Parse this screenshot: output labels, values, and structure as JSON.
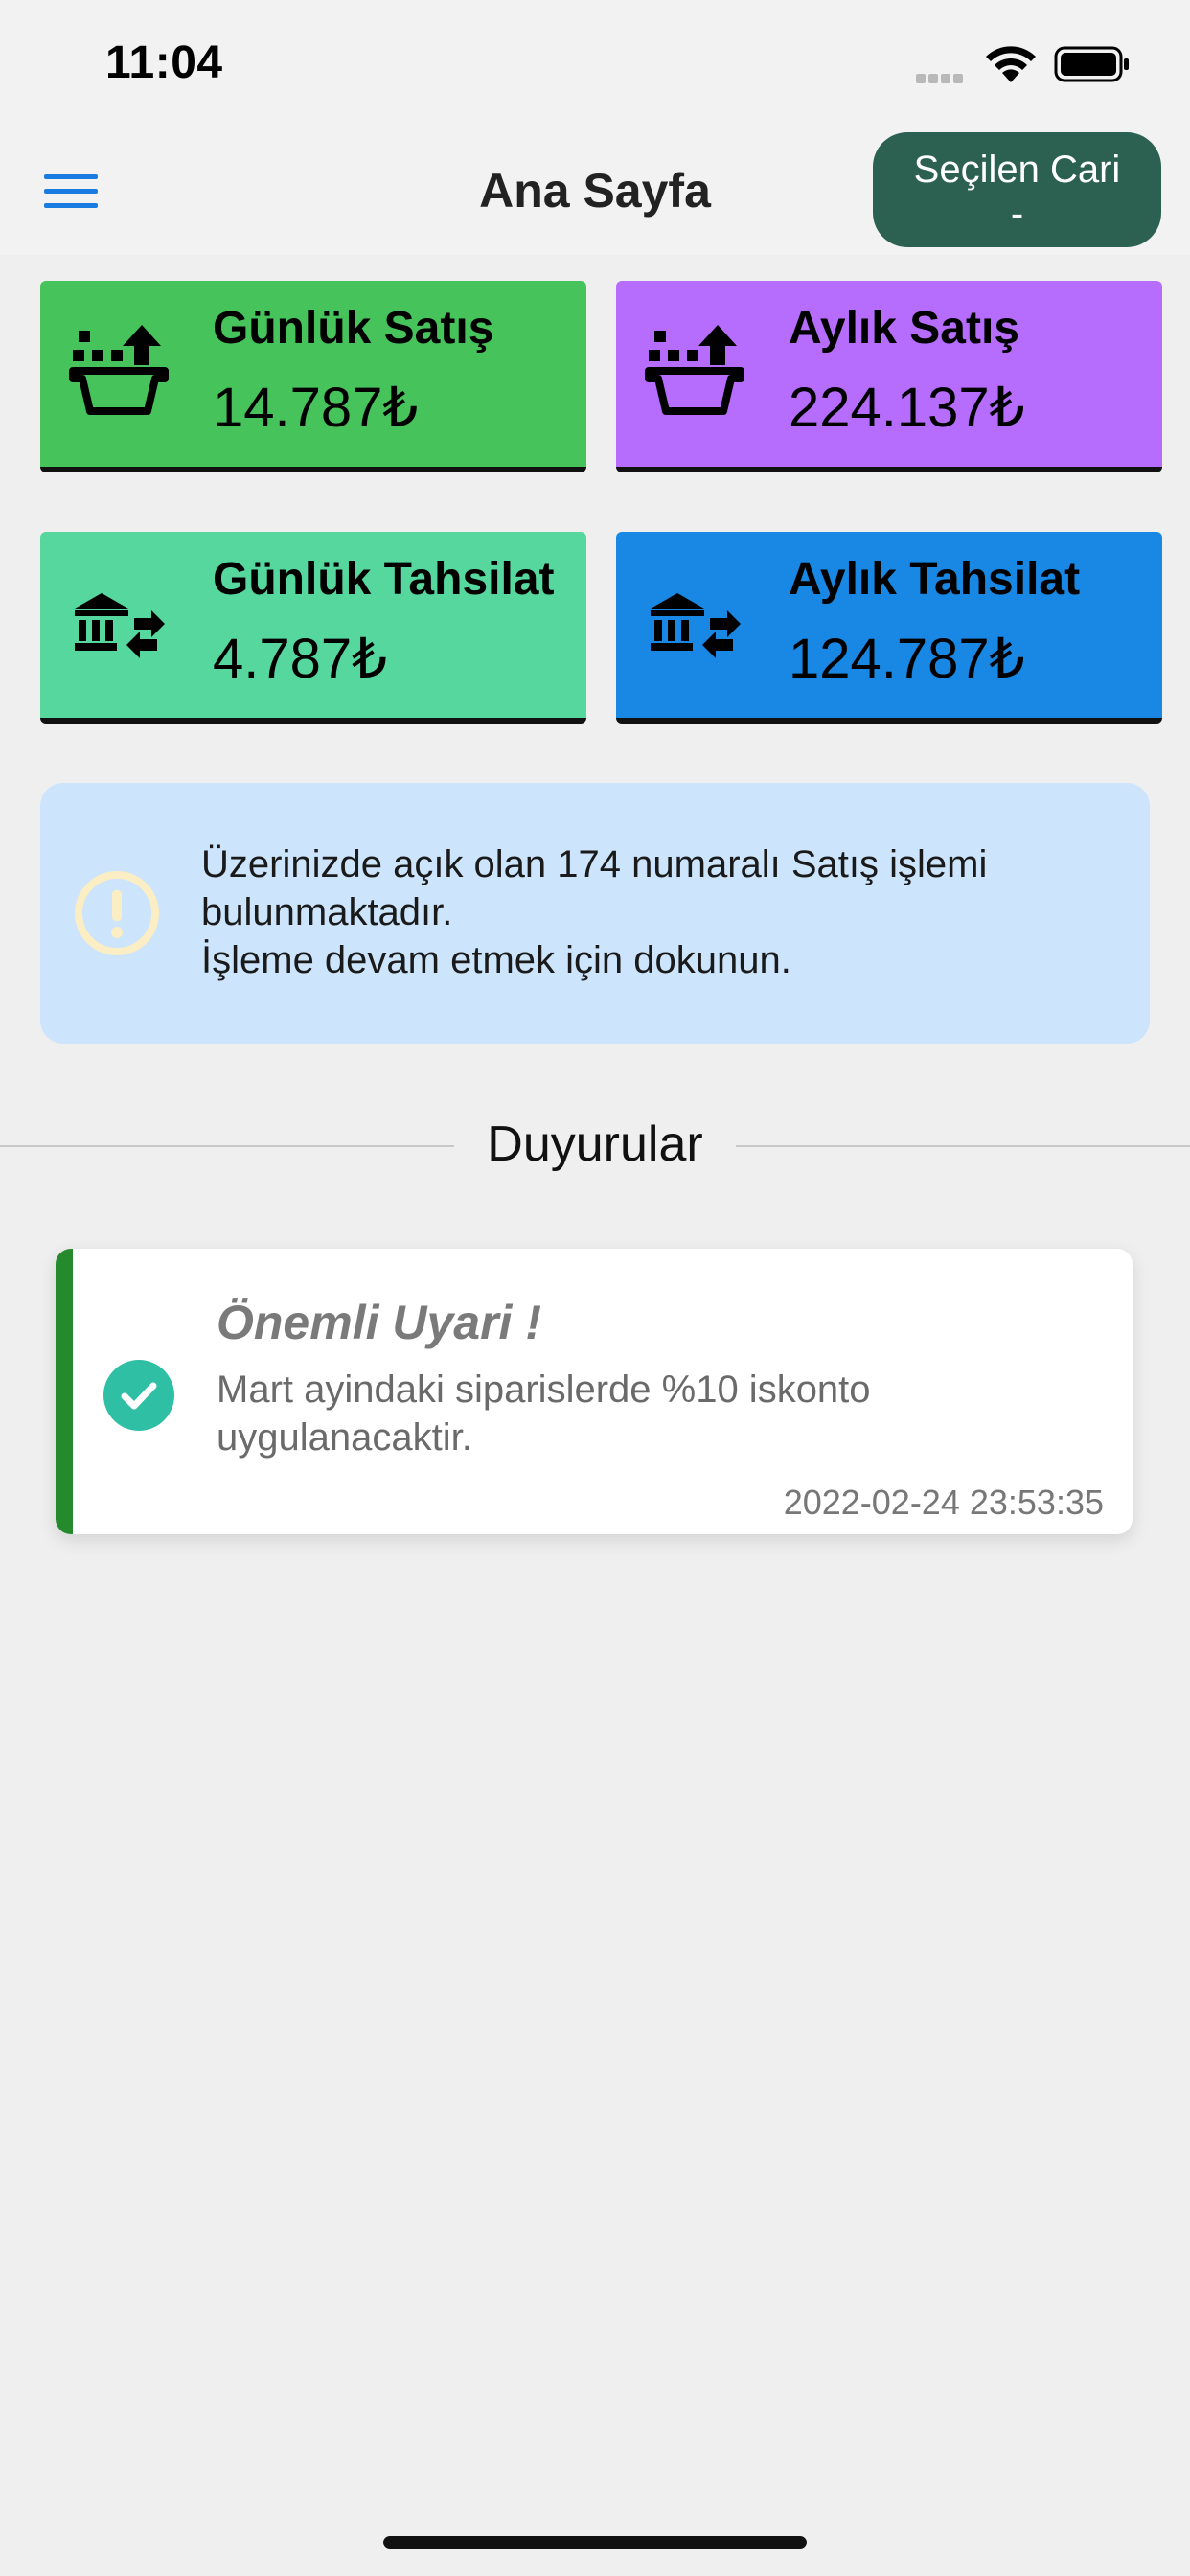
{
  "status_bar": {
    "time": "11:04"
  },
  "nav": {
    "title": "Ana Sayfa",
    "selected_cari_label": "Seçilen Cari",
    "selected_cari_value": "-"
  },
  "cards": [
    {
      "label": "Günlük Satış",
      "value": "14.787₺",
      "color": "#46c35b",
      "icon": "basket-upload-icon"
    },
    {
      "label": "Aylık Satış",
      "value": "224.137₺",
      "color": "#b66cfd",
      "icon": "basket-upload-icon"
    },
    {
      "label": "Günlük Tahsilat",
      "value": "4.787₺",
      "color": "#55d79e",
      "icon": "bank-transfer-icon"
    },
    {
      "label": "Aylık Tahsilat",
      "value": "124.787₺",
      "color": "#1888e4",
      "icon": "bank-transfer-icon"
    }
  ],
  "notice": {
    "line1": "Üzerinizde açık olan 174 numaralı Satış işlemi",
    "line2": "bulunmaktadır.",
    "line3": "İşleme devam etmek için dokunun.",
    "icon": "exclamation-circle-icon"
  },
  "section": {
    "title": "Duyurular"
  },
  "announcement": {
    "title": "Önemli Uyari !",
    "body": "Mart ayindaki siparislerde %10 iskonto uygulanacaktir.",
    "timestamp": "2022-02-24 23:53:35",
    "icon": "check-circle-icon"
  }
}
